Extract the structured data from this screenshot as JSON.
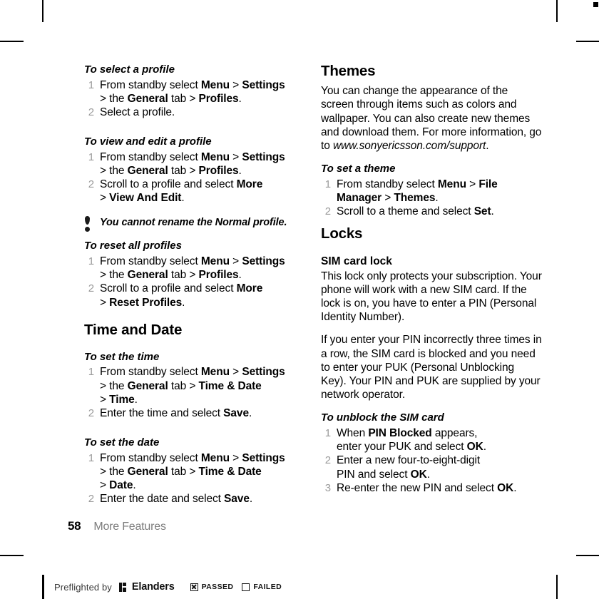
{
  "page": {
    "folio_number": "58",
    "folio_label": "More Features"
  },
  "left_column": {
    "proc_select_profile": {
      "heading": "To select a profile",
      "steps": [
        "From standby select Menu > Settings > the General tab > Profiles.",
        "Select a profile."
      ]
    },
    "proc_view_edit_profile": {
      "heading": "To view and edit a profile",
      "steps": [
        "From standby select Menu > Settings > the General tab > Profiles.",
        "Scroll to a profile and select More > View And Edit."
      ]
    },
    "note": {
      "icon": "exclamation-icon",
      "text": "You cannot rename the Normal profile."
    },
    "proc_reset_profiles": {
      "heading": "To reset all profiles",
      "steps": [
        "From standby select Menu > Settings > the General tab > Profiles.",
        "Scroll to a profile and select More > Reset Profiles."
      ]
    },
    "section_time_and_date": {
      "heading": "Time and Date"
    },
    "proc_set_time": {
      "heading": "To set the time",
      "steps": [
        "From standby select Menu > Settings > the General tab > Time & Date > Time.",
        "Enter the time and select Save."
      ]
    },
    "proc_set_date": {
      "heading": "To set the date",
      "steps": [
        "From standby select Menu > Settings > the General tab > Time & Date > Date.",
        "Enter the date and select Save."
      ]
    }
  },
  "right_column": {
    "section_themes": {
      "heading": "Themes",
      "body": "You can change the appearance of the screen through items such as colors and wallpaper. You can also create new themes and download them. For more information, go to ",
      "url": "www.sonyericsson.com/support"
    },
    "proc_set_theme": {
      "heading": "To set a theme",
      "steps": [
        "From standby select Menu > File Manager > Themes.",
        "Scroll to a theme and select Set."
      ]
    },
    "section_locks": {
      "heading": "Locks",
      "subheading": "SIM card lock",
      "paragraph_1": "This lock only protects your subscription. Your phone will work with a new SIM card. If the lock is on, you have to enter a PIN (Personal Identity Number).",
      "paragraph_2": "If you enter your PIN incorrectly three times in a row, the SIM card is blocked and you need to enter your PUK (Personal Unblocking Key). Your PIN and PUK are supplied by your network operator."
    },
    "proc_unblock_sim": {
      "heading": "To unblock the SIM card",
      "steps": [
        "When PIN Blocked appears, enter your PUK and select OK.",
        "Enter a new four-to-eight-digit PIN and select OK.",
        "Re-enter the new PIN and select OK."
      ]
    }
  },
  "preflight_bar": {
    "prefix": "Preflighted by",
    "brand": "Elanders",
    "passed_label": "PASSED",
    "failed_label": "FAILED",
    "passed_checked": true,
    "failed_checked": false
  }
}
